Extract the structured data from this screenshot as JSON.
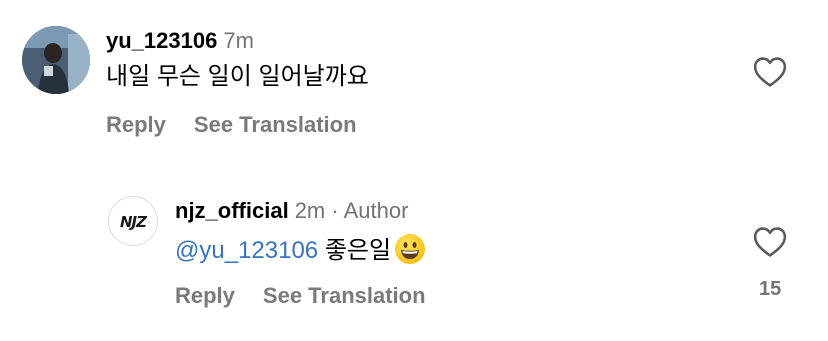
{
  "comments": [
    {
      "username": "yu_123106",
      "time": "7m",
      "text": "내일 무슨 일이 일어날까요",
      "actions": {
        "reply": "Reply",
        "translate": "See Translation"
      }
    },
    {
      "username": "njz_official",
      "time": "2m",
      "separator": "·",
      "author_label": "Author",
      "mention": "@yu_123106",
      "text": "좋은일",
      "emoji": "grinning-face",
      "actions": {
        "reply": "Reply",
        "translate": "See Translation"
      },
      "likes": "15"
    }
  ],
  "avatar_logo_text": "NJZ"
}
